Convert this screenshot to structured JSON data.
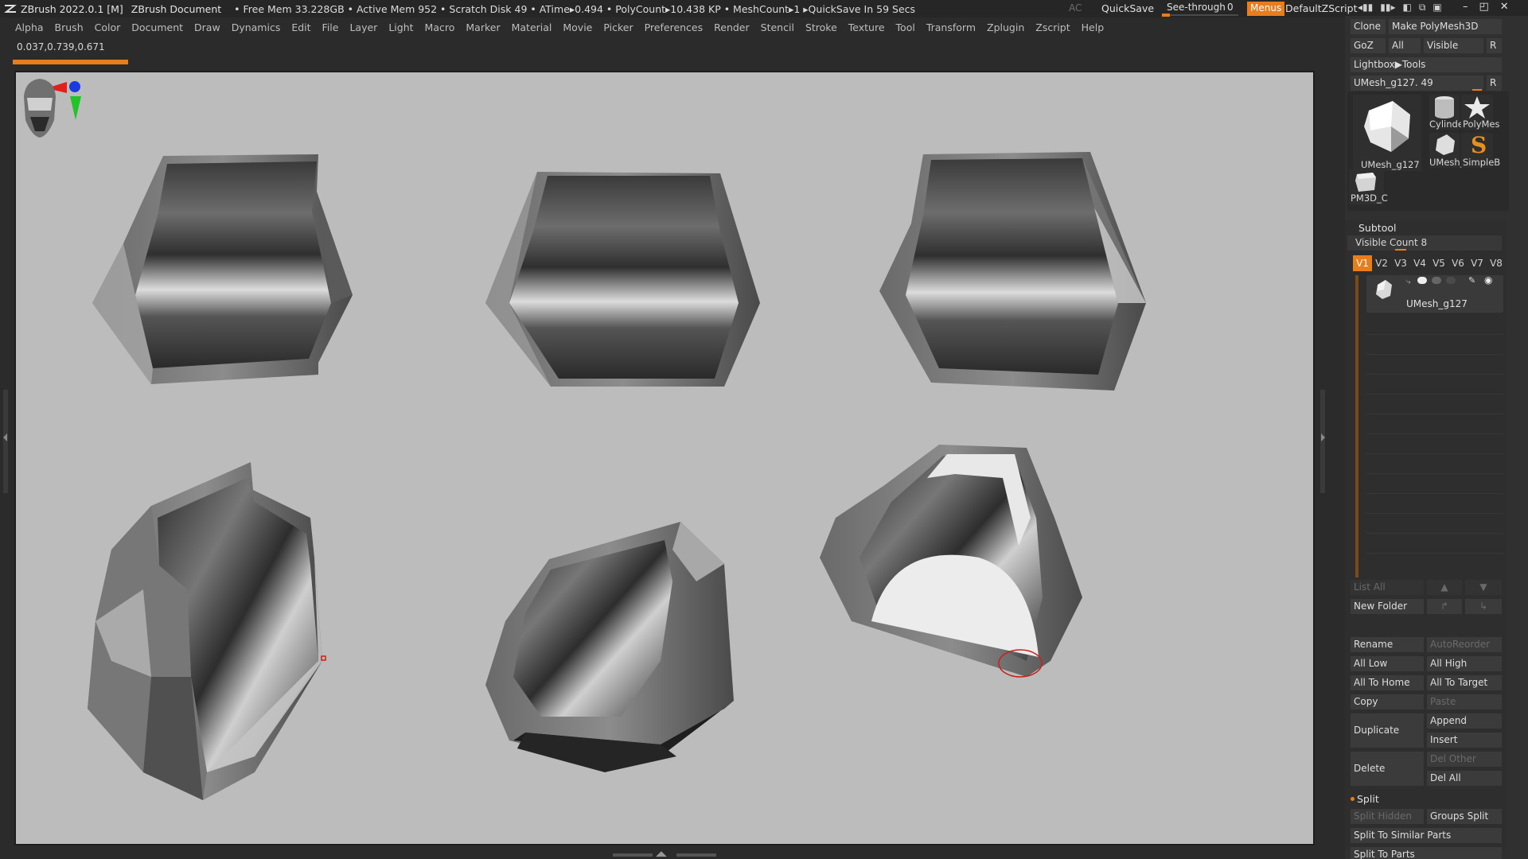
{
  "titlebar": {
    "app_title": "ZBrush 2022.0.1 [M]",
    "document": "ZBrush Document",
    "stats": "• Free Mem 33.228GB • Active Mem 952 • Scratch Disk 49 •  ATime▸0.494 • PolyCount▸10.438 KP  • MeshCount▸1   ▸QuickSave In 59 Secs",
    "ac": "AC",
    "quicksave": "QuickSave",
    "seethrough_label": "See-through",
    "seethrough_value": "0",
    "menus": "Menus",
    "script": "DefaultZScript"
  },
  "menubar": [
    "Alpha",
    "Brush",
    "Color",
    "Document",
    "Draw",
    "Dynamics",
    "Edit",
    "File",
    "Layer",
    "Light",
    "Macro",
    "Marker",
    "Material",
    "Movie",
    "Picker",
    "Preferences",
    "Render",
    "Stencil",
    "Stroke",
    "Texture",
    "Tool",
    "Transform",
    "Zplugin",
    "Zscript",
    "Help"
  ],
  "coords": "0.037,0.739,0.671",
  "tool_panel": {
    "clone": "Clone",
    "make_polymesh": "Make PolyMesh3D",
    "goz": "GoZ",
    "all": "All",
    "visible": "Visible",
    "r": "R",
    "lightbox_tools": "Lightbox▶Tools",
    "current_tool": "UMesh_g127. 49",
    "thumbs": [
      "UMesh_g127",
      "Cylinder",
      "PolyMes",
      "UMesh_",
      "SimpleB",
      "PM3D_C"
    ]
  },
  "subtool": {
    "title": "Subtool",
    "visible_count": "Visible Count 8",
    "versions": [
      "V1",
      "V2",
      "V3",
      "V4",
      "V5",
      "V6",
      "V7",
      "V8"
    ],
    "active_version": "V1",
    "items": [
      {
        "name": "UMesh_g127"
      }
    ],
    "list_all": "List All",
    "new_folder": "New Folder",
    "rename": "Rename",
    "auto_reorder": "AutoReorder",
    "all_low": "All Low",
    "all_high": "All High",
    "all_to_home": "All To Home",
    "all_to_target": "All To Target",
    "copy": "Copy",
    "paste": "Paste",
    "duplicate": "Duplicate",
    "append": "Append",
    "insert": "Insert",
    "delete": "Delete",
    "del_other": "Del Other",
    "del_all": "Del All",
    "split": "Split",
    "split_hidden": "Split Hidden",
    "groups_split": "Groups Split",
    "split_similar": "Split To Similar Parts",
    "split_parts": "Split To Parts"
  },
  "colors": {
    "accent": "#e87d1e",
    "canvas_bg": "#bcbcbc",
    "panel_bg": "#303030"
  }
}
